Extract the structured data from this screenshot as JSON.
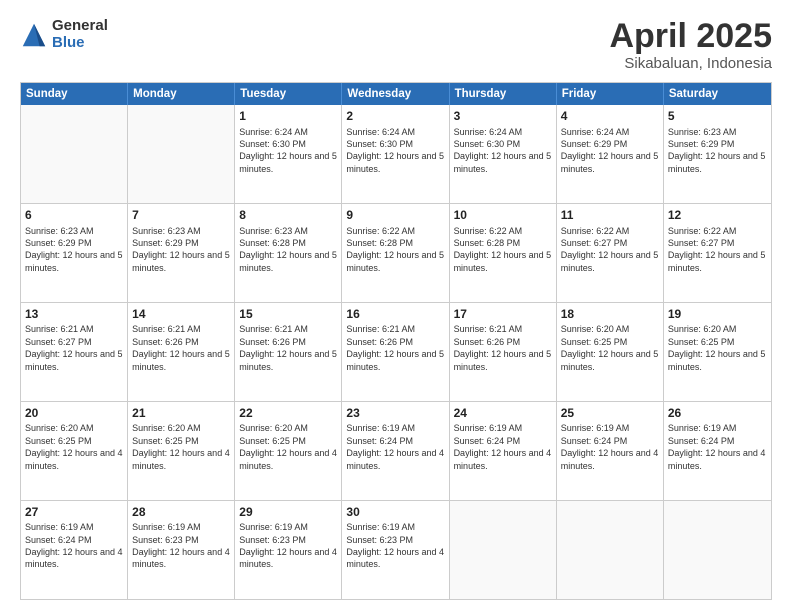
{
  "logo": {
    "general": "General",
    "blue": "Blue"
  },
  "title": {
    "month": "April 2025",
    "location": "Sikabaluan, Indonesia"
  },
  "weekdays": [
    "Sunday",
    "Monday",
    "Tuesday",
    "Wednesday",
    "Thursday",
    "Friday",
    "Saturday"
  ],
  "rows": [
    [
      {
        "day": "",
        "lines": []
      },
      {
        "day": "",
        "lines": []
      },
      {
        "day": "1",
        "lines": [
          "Sunrise: 6:24 AM",
          "Sunset: 6:30 PM",
          "Daylight: 12 hours and 5 minutes."
        ]
      },
      {
        "day": "2",
        "lines": [
          "Sunrise: 6:24 AM",
          "Sunset: 6:30 PM",
          "Daylight: 12 hours and 5 minutes."
        ]
      },
      {
        "day": "3",
        "lines": [
          "Sunrise: 6:24 AM",
          "Sunset: 6:30 PM",
          "Daylight: 12 hours and 5 minutes."
        ]
      },
      {
        "day": "4",
        "lines": [
          "Sunrise: 6:24 AM",
          "Sunset: 6:29 PM",
          "Daylight: 12 hours and 5 minutes."
        ]
      },
      {
        "day": "5",
        "lines": [
          "Sunrise: 6:23 AM",
          "Sunset: 6:29 PM",
          "Daylight: 12 hours and 5 minutes."
        ]
      }
    ],
    [
      {
        "day": "6",
        "lines": [
          "Sunrise: 6:23 AM",
          "Sunset: 6:29 PM",
          "Daylight: 12 hours and 5 minutes."
        ]
      },
      {
        "day": "7",
        "lines": [
          "Sunrise: 6:23 AM",
          "Sunset: 6:29 PM",
          "Daylight: 12 hours and 5 minutes."
        ]
      },
      {
        "day": "8",
        "lines": [
          "Sunrise: 6:23 AM",
          "Sunset: 6:28 PM",
          "Daylight: 12 hours and 5 minutes."
        ]
      },
      {
        "day": "9",
        "lines": [
          "Sunrise: 6:22 AM",
          "Sunset: 6:28 PM",
          "Daylight: 12 hours and 5 minutes."
        ]
      },
      {
        "day": "10",
        "lines": [
          "Sunrise: 6:22 AM",
          "Sunset: 6:28 PM",
          "Daylight: 12 hours and 5 minutes."
        ]
      },
      {
        "day": "11",
        "lines": [
          "Sunrise: 6:22 AM",
          "Sunset: 6:27 PM",
          "Daylight: 12 hours and 5 minutes."
        ]
      },
      {
        "day": "12",
        "lines": [
          "Sunrise: 6:22 AM",
          "Sunset: 6:27 PM",
          "Daylight: 12 hours and 5 minutes."
        ]
      }
    ],
    [
      {
        "day": "13",
        "lines": [
          "Sunrise: 6:21 AM",
          "Sunset: 6:27 PM",
          "Daylight: 12 hours and 5 minutes."
        ]
      },
      {
        "day": "14",
        "lines": [
          "Sunrise: 6:21 AM",
          "Sunset: 6:26 PM",
          "Daylight: 12 hours and 5 minutes."
        ]
      },
      {
        "day": "15",
        "lines": [
          "Sunrise: 6:21 AM",
          "Sunset: 6:26 PM",
          "Daylight: 12 hours and 5 minutes."
        ]
      },
      {
        "day": "16",
        "lines": [
          "Sunrise: 6:21 AM",
          "Sunset: 6:26 PM",
          "Daylight: 12 hours and 5 minutes."
        ]
      },
      {
        "day": "17",
        "lines": [
          "Sunrise: 6:21 AM",
          "Sunset: 6:26 PM",
          "Daylight: 12 hours and 5 minutes."
        ]
      },
      {
        "day": "18",
        "lines": [
          "Sunrise: 6:20 AM",
          "Sunset: 6:25 PM",
          "Daylight: 12 hours and 5 minutes."
        ]
      },
      {
        "day": "19",
        "lines": [
          "Sunrise: 6:20 AM",
          "Sunset: 6:25 PM",
          "Daylight: 12 hours and 5 minutes."
        ]
      }
    ],
    [
      {
        "day": "20",
        "lines": [
          "Sunrise: 6:20 AM",
          "Sunset: 6:25 PM",
          "Daylight: 12 hours and 4 minutes."
        ]
      },
      {
        "day": "21",
        "lines": [
          "Sunrise: 6:20 AM",
          "Sunset: 6:25 PM",
          "Daylight: 12 hours and 4 minutes."
        ]
      },
      {
        "day": "22",
        "lines": [
          "Sunrise: 6:20 AM",
          "Sunset: 6:25 PM",
          "Daylight: 12 hours and 4 minutes."
        ]
      },
      {
        "day": "23",
        "lines": [
          "Sunrise: 6:19 AM",
          "Sunset: 6:24 PM",
          "Daylight: 12 hours and 4 minutes."
        ]
      },
      {
        "day": "24",
        "lines": [
          "Sunrise: 6:19 AM",
          "Sunset: 6:24 PM",
          "Daylight: 12 hours and 4 minutes."
        ]
      },
      {
        "day": "25",
        "lines": [
          "Sunrise: 6:19 AM",
          "Sunset: 6:24 PM",
          "Daylight: 12 hours and 4 minutes."
        ]
      },
      {
        "day": "26",
        "lines": [
          "Sunrise: 6:19 AM",
          "Sunset: 6:24 PM",
          "Daylight: 12 hours and 4 minutes."
        ]
      }
    ],
    [
      {
        "day": "27",
        "lines": [
          "Sunrise: 6:19 AM",
          "Sunset: 6:24 PM",
          "Daylight: 12 hours and 4 minutes."
        ]
      },
      {
        "day": "28",
        "lines": [
          "Sunrise: 6:19 AM",
          "Sunset: 6:23 PM",
          "Daylight: 12 hours and 4 minutes."
        ]
      },
      {
        "day": "29",
        "lines": [
          "Sunrise: 6:19 AM",
          "Sunset: 6:23 PM",
          "Daylight: 12 hours and 4 minutes."
        ]
      },
      {
        "day": "30",
        "lines": [
          "Sunrise: 6:19 AM",
          "Sunset: 6:23 PM",
          "Daylight: 12 hours and 4 minutes."
        ]
      },
      {
        "day": "",
        "lines": []
      },
      {
        "day": "",
        "lines": []
      },
      {
        "day": "",
        "lines": []
      }
    ]
  ]
}
